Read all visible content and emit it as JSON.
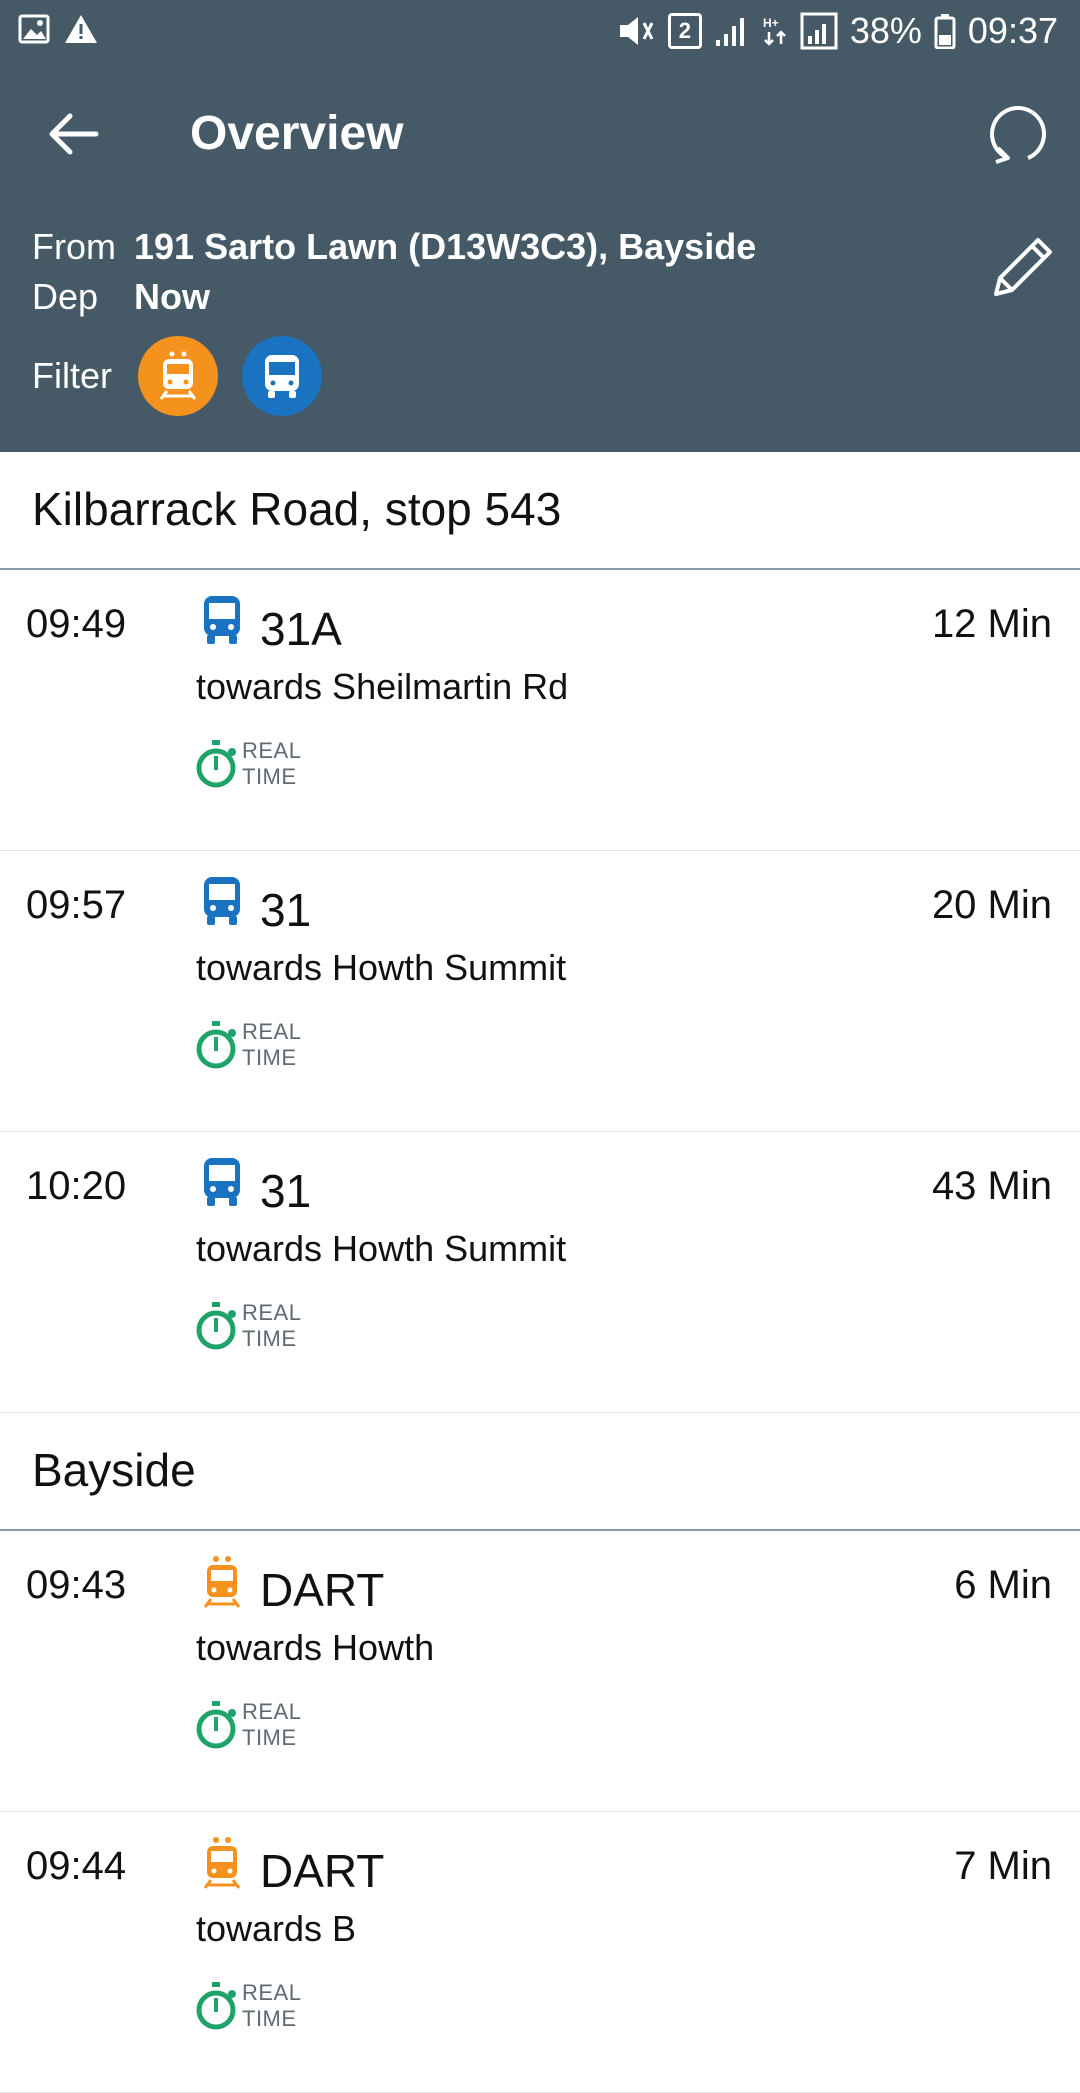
{
  "status_bar": {
    "battery": "38%",
    "time": "09:37",
    "sim_badge": "2",
    "icons": [
      "gallery-icon",
      "warning-icon",
      "mute-icon",
      "signal-icon",
      "data-icon",
      "signal-icon",
      "battery-icon"
    ]
  },
  "toolbar": {
    "title": "Overview"
  },
  "trip": {
    "from_label": "From",
    "from_value": "191 Sarto Lawn (D13W3C3), Bayside",
    "dep_label": "Dep",
    "dep_value": "Now",
    "filter_label": "Filter"
  },
  "colors": {
    "header": "#455a66",
    "train": "#f5921e",
    "bus": "#1a73c0",
    "realtime": "#1fa36b"
  },
  "sections": [
    {
      "name": "Kilbarrack Road, stop 543",
      "departures": [
        {
          "time": "09:49",
          "mode": "bus",
          "route": "31A",
          "destination": "towards Sheilmartin Rd",
          "minutes": "12 Min",
          "realtime_top": "REAL",
          "realtime_bottom": "TIME"
        },
        {
          "time": "09:57",
          "mode": "bus",
          "route": "31",
          "destination": "towards Howth Summit",
          "minutes": "20 Min",
          "realtime_top": "REAL",
          "realtime_bottom": "TIME"
        },
        {
          "time": "10:20",
          "mode": "bus",
          "route": "31",
          "destination": "towards Howth Summit",
          "minutes": "43 Min",
          "realtime_top": "REAL",
          "realtime_bottom": "TIME"
        }
      ]
    },
    {
      "name": "Bayside",
      "departures": [
        {
          "time": "09:43",
          "mode": "train",
          "route": "DART",
          "destination": "towards Howth",
          "minutes": "6 Min",
          "realtime_top": "REAL",
          "realtime_bottom": "TIME"
        },
        {
          "time": "09:44",
          "mode": "train",
          "route": "DART",
          "destination": "towards B",
          "minutes": "7 Min",
          "realtime_top": "REAL",
          "realtime_bottom": "TIME"
        }
      ]
    }
  ]
}
